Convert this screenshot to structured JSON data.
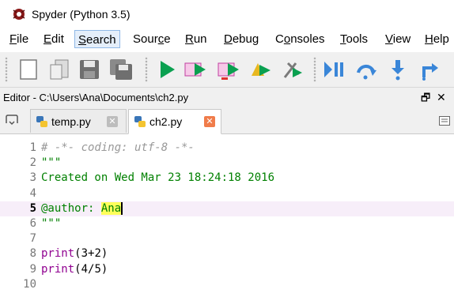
{
  "window": {
    "title": "Spyder (Python 3.5)"
  },
  "menu": [
    {
      "key": "F",
      "rest": "ile"
    },
    {
      "key": "E",
      "rest": "dit"
    },
    {
      "key": "S",
      "rest": "earch"
    },
    {
      "pre": "Sour",
      "key": "c",
      "rest": "e"
    },
    {
      "key": "R",
      "rest": "un"
    },
    {
      "key": "D",
      "rest": "ebug"
    },
    {
      "pre": "C",
      "key": "o",
      "rest": "nsoles"
    },
    {
      "key": "T",
      "rest": "ools"
    },
    {
      "key": "V",
      "rest": "iew"
    },
    {
      "key": "H",
      "rest": "elp"
    }
  ],
  "toolbar": {
    "buttons": [
      "new-file-icon",
      "open-file-icon",
      "save-icon",
      "save-all-icon",
      "run-icon",
      "run-cell-icon",
      "run-cell-advance-icon",
      "run-selection-icon",
      "run-config-icon",
      "debug-icon",
      "step-icon",
      "step-into-icon",
      "step-return-icon"
    ]
  },
  "editor": {
    "pane_title": "Editor - C:\\Users\\Ana\\Documents\\ch2.py",
    "float_icon": "🗗",
    "close_icon": "✕",
    "tabs": [
      {
        "label": "temp.py",
        "close": "✕",
        "active": false
      },
      {
        "label": "ch2.py",
        "close": "✕",
        "active": true
      }
    ],
    "lines": [
      {
        "n": "1",
        "parts": [
          {
            "t": "# -*- coding: utf-8 -*-",
            "c": "comment"
          }
        ]
      },
      {
        "n": "2",
        "parts": [
          {
            "t": "\"\"\"",
            "c": "string"
          }
        ]
      },
      {
        "n": "3",
        "parts": [
          {
            "t": "Created on Wed Mar 23 18:24:18 2016",
            "c": "string"
          }
        ]
      },
      {
        "n": "4",
        "parts": [
          {
            "t": "",
            "c": "string"
          }
        ]
      },
      {
        "n": "5",
        "current": true,
        "parts": [
          {
            "t": "@author: ",
            "c": "string"
          },
          {
            "t": "Ana",
            "c": "author-hl"
          }
        ]
      },
      {
        "n": "6",
        "parts": [
          {
            "t": "\"\"\"",
            "c": "string"
          }
        ]
      },
      {
        "n": "7",
        "parts": [
          {
            "t": "",
            "c": "plain"
          }
        ]
      },
      {
        "n": "8",
        "parts": [
          {
            "t": "print",
            "c": "builtin"
          },
          {
            "t": "(3+2)",
            "c": "plain"
          }
        ]
      },
      {
        "n": "9",
        "parts": [
          {
            "t": "print",
            "c": "builtin"
          },
          {
            "t": "(4/5)",
            "c": "plain"
          }
        ]
      },
      {
        "n": "10",
        "parts": [
          {
            "t": "",
            "c": "plain"
          }
        ]
      }
    ]
  },
  "colors": {
    "accent_green": "#0aa050",
    "tab_close_active": "#f07c4a",
    "current_line": "#f7eef9"
  }
}
